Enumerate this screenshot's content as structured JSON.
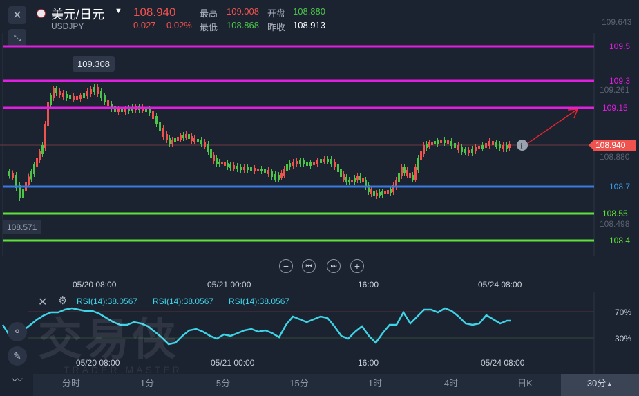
{
  "header": {
    "pair_name": "美元/日元",
    "pair_code": "USDJPY",
    "price": "108.940",
    "change": "0.027",
    "change_pct": "0.02%",
    "high_label": "最高",
    "high": "109.008",
    "open_label": "开盘",
    "open": "108.880",
    "low_label": "最低",
    "low": "108.868",
    "prev_label": "昨收",
    "prev": "108.913"
  },
  "price_axis": {
    "top": "109.643",
    "p1093b": "109.261",
    "p10888": "108.880",
    "p108498": "108.498"
  },
  "levels": [
    {
      "label": "109.5",
      "color": "#e01fe0"
    },
    {
      "label": "109.3",
      "color": "#e01fe0"
    },
    {
      "label": "109.15",
      "color": "#e01fe0"
    },
    {
      "label": "108.7",
      "color": "#3a7be0"
    },
    {
      "label": "108.55",
      "color": "#5fe03a"
    },
    {
      "label": "108.4",
      "color": "#5fe03a"
    }
  ],
  "current_price_tag": "108.940",
  "max_tooltip": "109.308",
  "min_label": "108.571",
  "time_axis": [
    "05/20 08:00",
    "05/21 00:00",
    "16:00",
    "05/24 08:00"
  ],
  "rsi": {
    "label1": "RSI(14):38.0567",
    "label2": "RSI(14):38.0567",
    "label3": "RSI(14):38.0567",
    "level70": "70%",
    "level30": "30%"
  },
  "watermark": {
    "cn": "交易侠",
    "en": "TRADER MASTER"
  },
  "tabs": [
    "分时",
    "1分",
    "5分",
    "15分",
    "1时",
    "4时",
    "日K",
    "30分"
  ],
  "active_tab_suffix": "▲",
  "icons": {
    "close": "close-icon",
    "collapse": "collapse-icon",
    "zoom_out": "zoom-out-icon",
    "prev": "step-back-icon",
    "next": "step-forward-icon",
    "zoom_in": "zoom-in-icon"
  },
  "colors": {
    "bg": "#1b2230",
    "up": "#f0524d",
    "down": "#4cc44a",
    "rsi": "#3fd3e6"
  }
}
